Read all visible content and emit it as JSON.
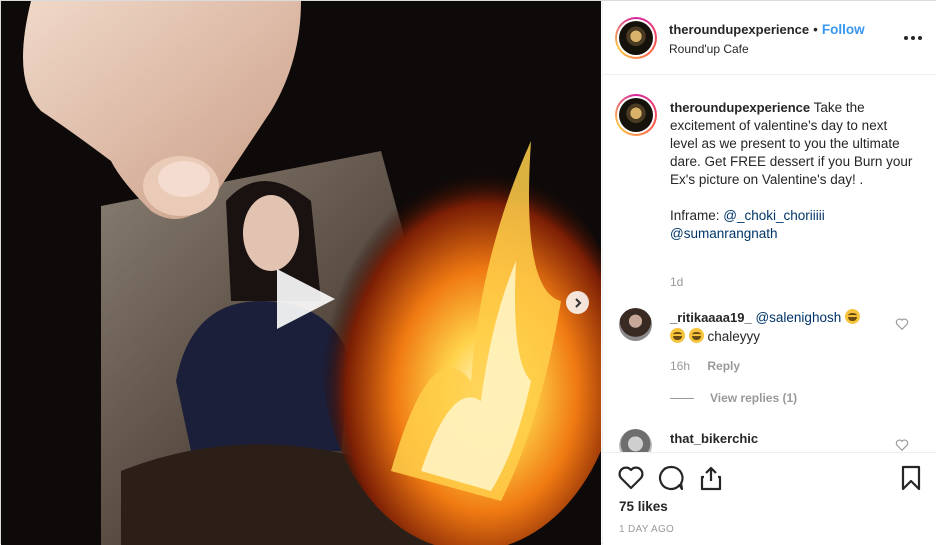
{
  "header": {
    "username": "theroundupexperience",
    "separator": "•",
    "follow_label": "Follow",
    "location": "Round'up Cafe",
    "more_icon": "more-horizontal-icon"
  },
  "caption": {
    "username": "theroundupexperience",
    "text": "Take the excitement of valentine's day to next level as we present to you the ultimate dare. Get FREE dessert if you Burn your Ex's picture on Valentine's day! .",
    "inframe_label": "Inframe:",
    "mention_1": "@_choki_choriiiii",
    "mention_2": "@sumanrangnath",
    "time": "1d"
  },
  "comments": [
    {
      "username": "_ritikaaaa19_",
      "mention": "@salenighosh",
      "text": "chaleyyy",
      "time": "16h",
      "reply_label": "Reply",
      "view_replies": "View replies (1)"
    },
    {
      "username": "that_bikerchic"
    }
  ],
  "footer": {
    "likes": "75 likes",
    "date": "1 DAY AGO"
  },
  "media": {
    "play_icon": "play-icon",
    "next_icon": "chevron-right-icon"
  },
  "colors": {
    "follow": "#3897f0",
    "link": "#003569",
    "muted": "#999999"
  }
}
